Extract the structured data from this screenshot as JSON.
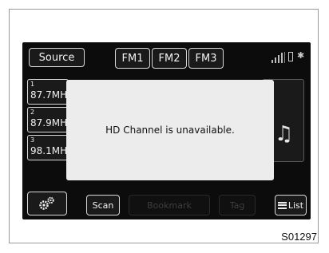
{
  "header": {
    "source_label": "Source",
    "bands": [
      "FM1",
      "FM2",
      "FM3"
    ]
  },
  "status_icons": [
    "signal-bars-icon",
    "phone-battery-icon",
    "bluetooth-icon",
    "settings-icon"
  ],
  "presets": [
    {
      "number": "1",
      "frequency": "87.7MH"
    },
    {
      "number": "2",
      "frequency": "87.9MH"
    },
    {
      "number": "3",
      "frequency": "98.1MH"
    }
  ],
  "popup": {
    "message": "HD Channel is unavailable."
  },
  "toolbar": {
    "scan_label": "Scan",
    "bookmark_label": "Bookmark",
    "tag_label": "Tag",
    "list_label": "List"
  },
  "caption": "S01297",
  "colors": {
    "screen_bg": "#0c0c0c",
    "popup_bg": "#ececec",
    "button_border": "#d9d9d9",
    "disabled_text": "#3d3d3d"
  }
}
